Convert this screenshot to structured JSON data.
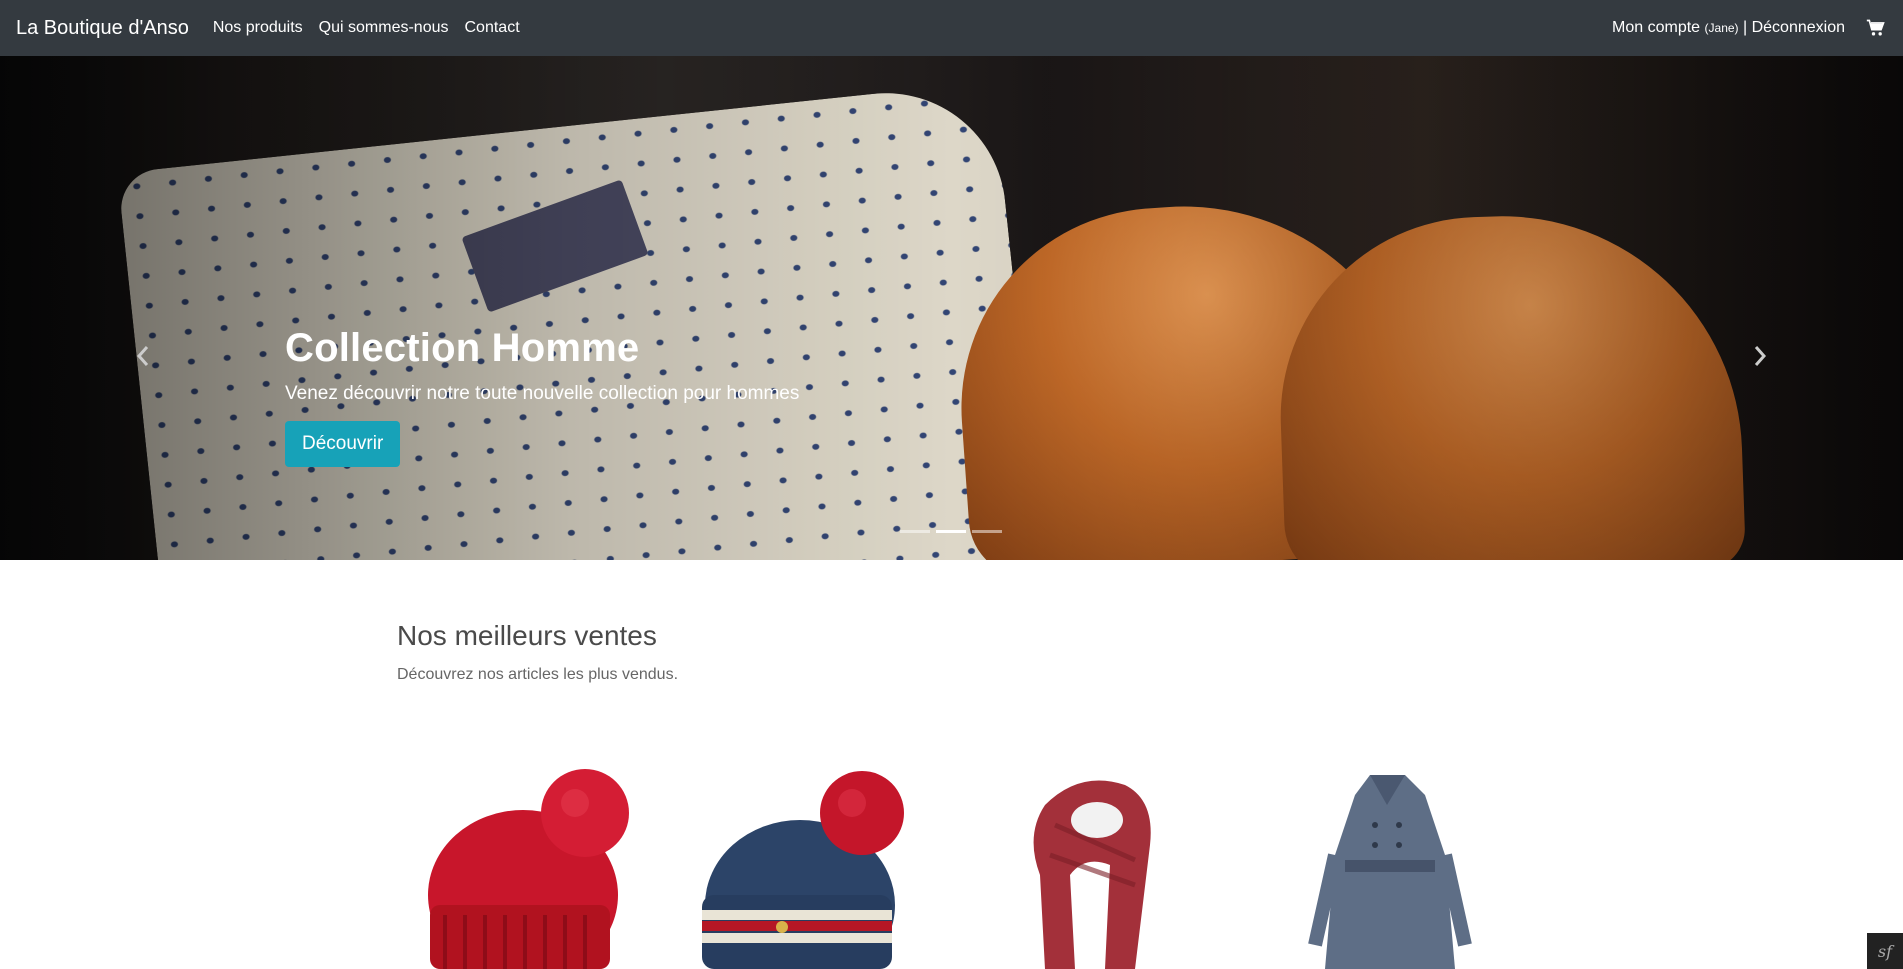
{
  "navbar": {
    "brand": "La Boutique d'Anso",
    "links": [
      "Nos produits",
      "Qui sommes-nous",
      "Contact"
    ],
    "account": "Mon compte",
    "user_open": "( ",
    "user": "Jane",
    "user_close": " )",
    "separator": " | ",
    "logout": "Déconnexion",
    "cart_icon": "shopping-cart-icon"
  },
  "carousel": {
    "title": "Collection Homme",
    "subtitle": "Venez découvrir notre toute nouvelle collection pour hommes",
    "button": "Découvrir",
    "button_color": "#17a2b8",
    "active_slide": 2,
    "slides": 3,
    "prev_icon": "chevron-left-icon",
    "next_icon": "chevron-right-icon"
  },
  "best_sellers": {
    "title": "Nos meilleurs ventes",
    "subtitle": "Découvrez nos articles les plus vendus.",
    "products": [
      {
        "name": "red-beanie"
      },
      {
        "name": "navy-striped-beanie"
      },
      {
        "name": "red-scarf"
      },
      {
        "name": "grey-coat"
      }
    ]
  },
  "colors": {
    "navbar_bg": "#343a40",
    "accent": "#17a2b8"
  },
  "toolbar": {
    "icon": "symfony-icon",
    "label": "sf"
  }
}
